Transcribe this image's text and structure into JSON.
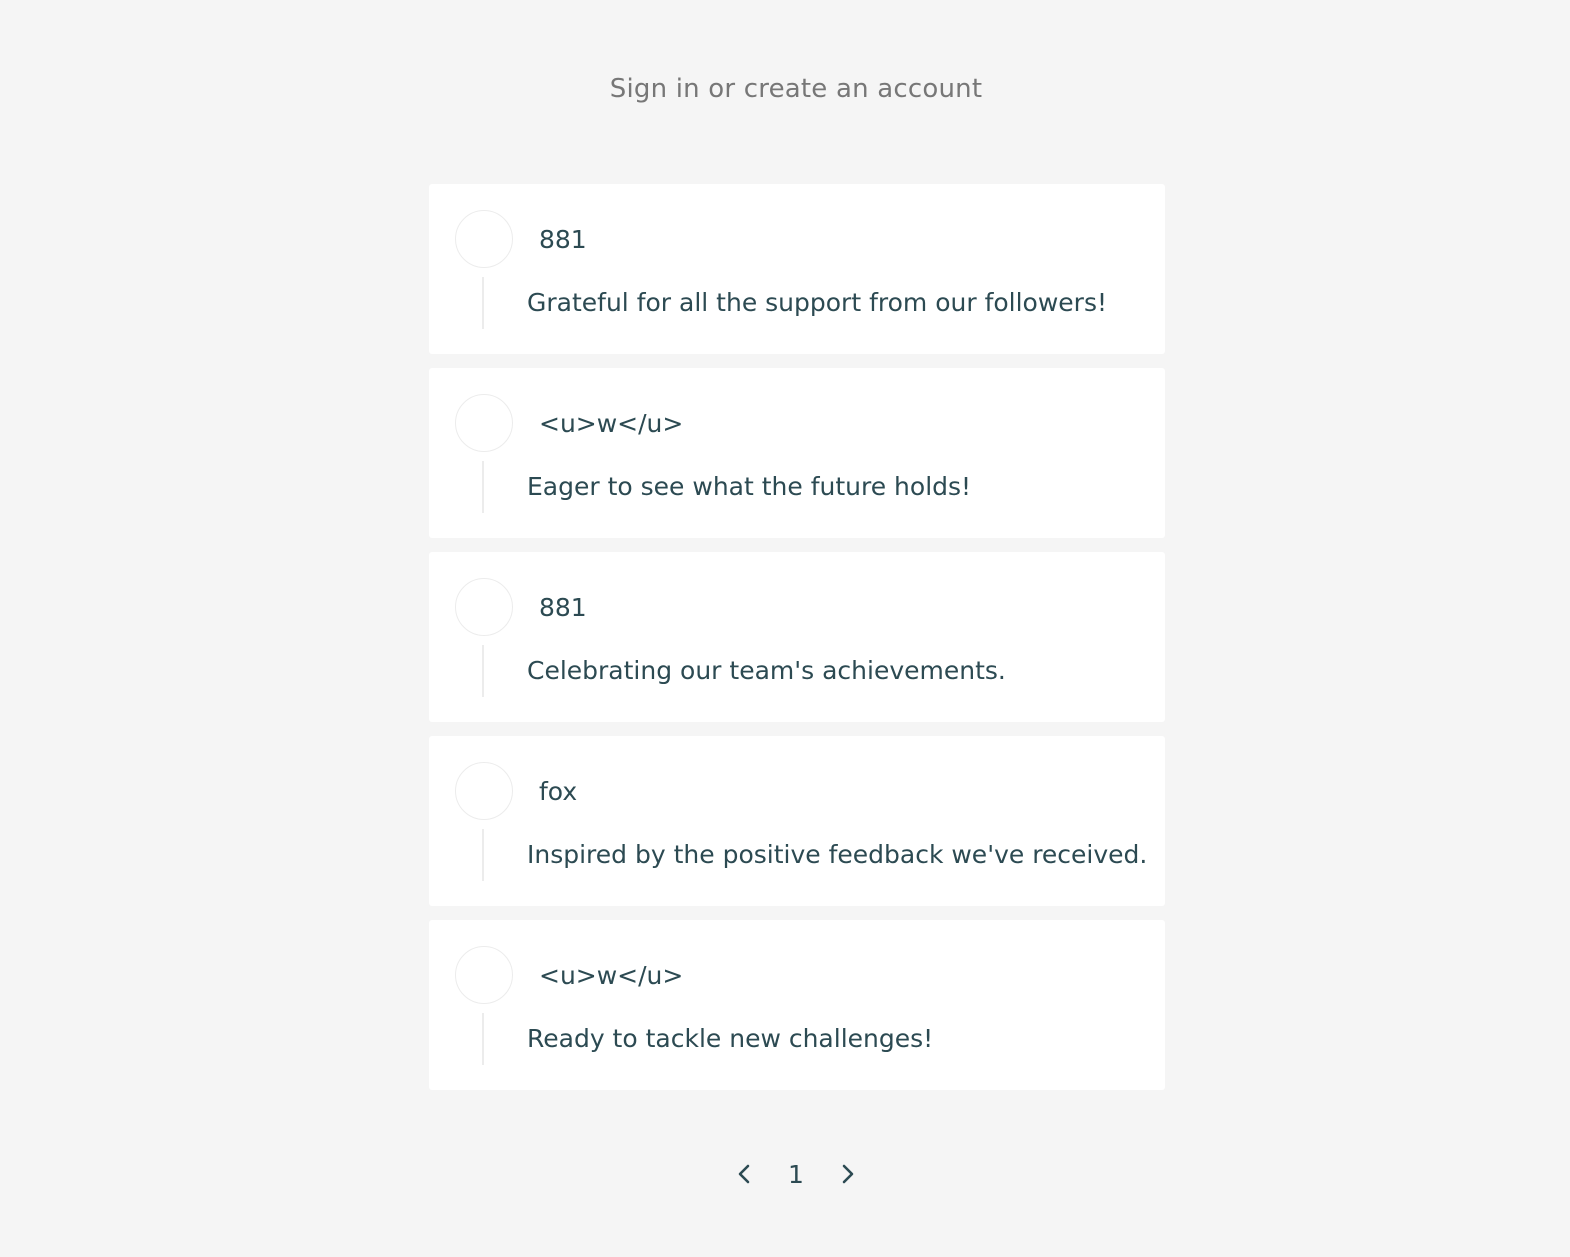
{
  "header": {
    "signin_label": "Sign in or create an account"
  },
  "posts": [
    {
      "author": "881",
      "text": "Grateful for all the support from our followers!"
    },
    {
      "author": "<u>w</u>",
      "text": "Eager to see what the future holds!"
    },
    {
      "author": "881",
      "text": "Celebrating our team's achievements."
    },
    {
      "author": "fox",
      "text": "Inspired by the positive feedback we've received."
    },
    {
      "author": "<u>w</u>",
      "text": "Ready to tackle new challenges!"
    }
  ],
  "pagination": {
    "prev_icon": "chevron-left-icon",
    "current_page": "1",
    "next_icon": "chevron-right-icon"
  },
  "colors": {
    "background": "#f5f5f5",
    "card": "#ffffff",
    "text": "#2c4a52",
    "muted": "#777777"
  }
}
